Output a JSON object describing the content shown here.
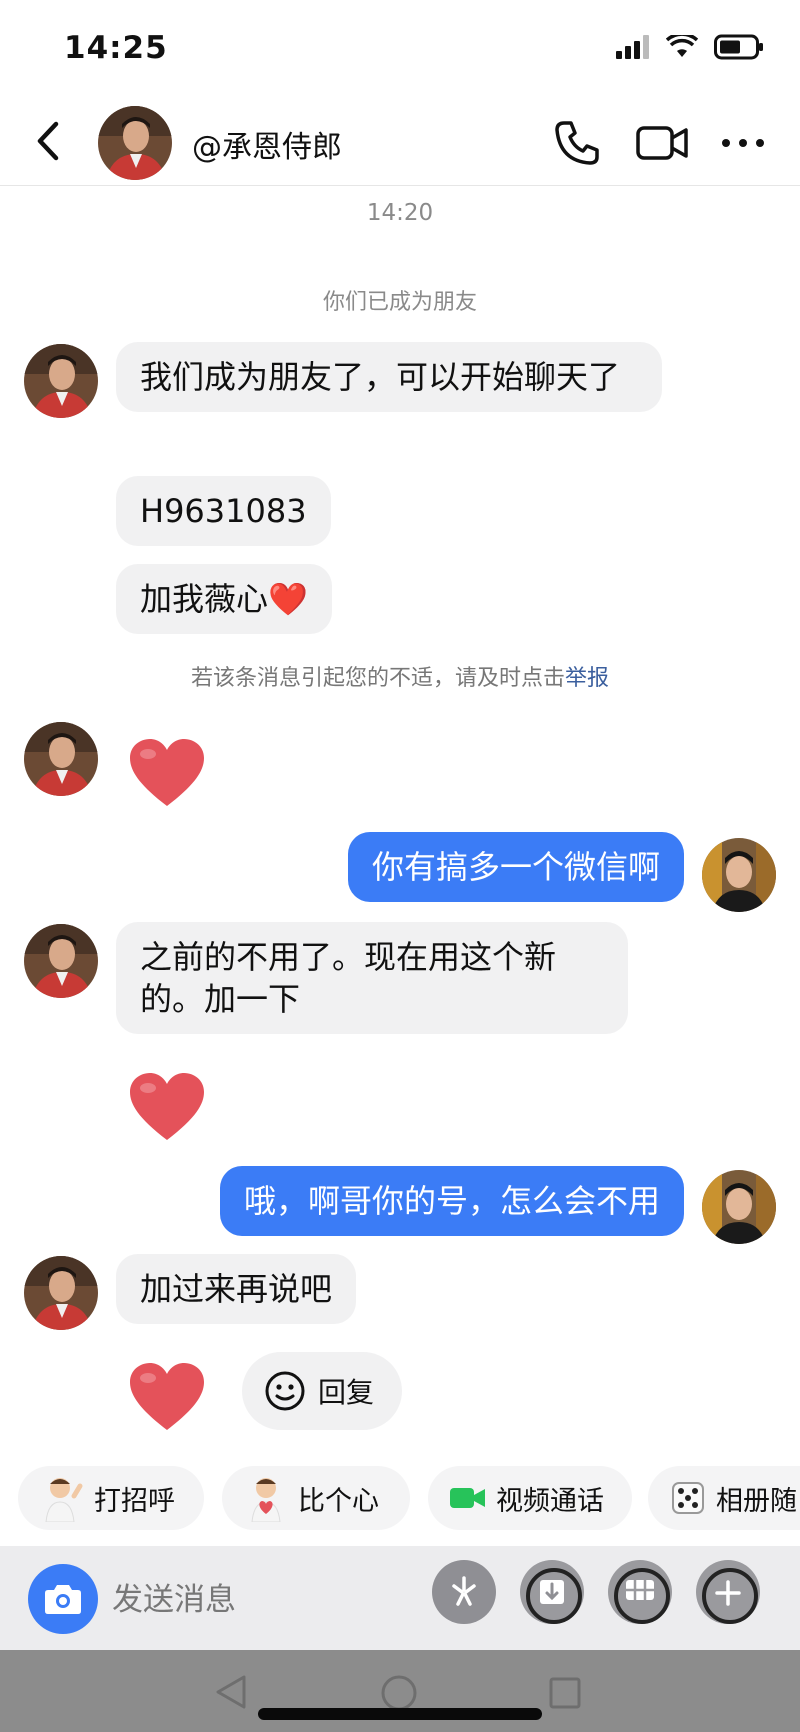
{
  "status_bar": {
    "time": "14:25"
  },
  "header": {
    "contact_name": "@承恩侍郎"
  },
  "chat": {
    "timestamp": "14:20",
    "system_message": "你们已成为朋友",
    "messages": [
      {
        "from": "them",
        "text": "我们成为朋友了，可以开始聊天了"
      },
      {
        "from": "them",
        "text": "H9631083"
      },
      {
        "from": "them",
        "text": "加我薇心❤️"
      },
      {
        "from": "me",
        "text": "你有搞多一个微信啊"
      },
      {
        "from": "them",
        "text": "之前的不用了。现在用这个新的。加一下"
      },
      {
        "from": "me",
        "text": "哦，啊哥你的号，怎么会不用"
      },
      {
        "from": "them",
        "text": "加过来再说吧"
      }
    ],
    "notice_text": "若该条消息引起您的不适，请及时点击",
    "notice_link": "举报",
    "reply_chip_label": "回复"
  },
  "quick_actions": [
    {
      "label": "打招呼",
      "icon": "wave-emoji-icon"
    },
    {
      "label": "比个心",
      "icon": "heart-gesture-emoji-icon"
    },
    {
      "label": "视频通话",
      "icon": "video-camera-icon"
    },
    {
      "label": "相册随",
      "icon": "dice-icon"
    }
  ],
  "input_bar": {
    "placeholder": "发送消息"
  },
  "colors": {
    "accent": "#3b7cf6",
    "incoming_bubble": "#f1f1f2",
    "heart": "#e4525a"
  }
}
